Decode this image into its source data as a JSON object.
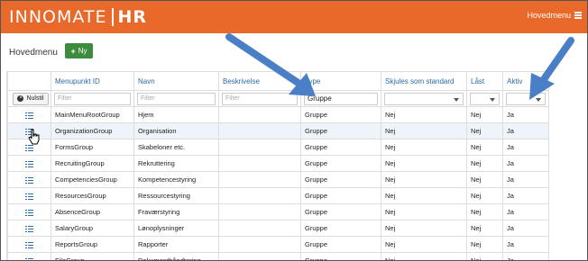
{
  "header": {
    "brand_name": "INNOMATE",
    "brand_suffix": "HR",
    "menu_label": "Hovedmenu",
    "color": "#e8692a"
  },
  "page": {
    "title": "Hovedmenu",
    "new_button": "Ny",
    "new_button_color": "#3d8b3d"
  },
  "grid": {
    "columns": [
      "Menupunkt ID",
      "Navn",
      "Beskrivelse",
      "Type",
      "Skjules som standard",
      "Låst",
      "Aktiv"
    ],
    "reset_label": "Nulstil",
    "filters": {
      "menupunkt_placeholder": "Filter",
      "navn_placeholder": "Filter",
      "beskrivelse_placeholder": "Filter",
      "type_value": "Gruppe"
    },
    "rows": [
      {
        "id": "MainMenuRootGroup",
        "navn": "Hjem",
        "beskrivelse": "",
        "type": "Gruppe",
        "skjules": "Nej",
        "laast": "Nej",
        "aktiv": "Ja"
      },
      {
        "id": "OrganizationGroup",
        "navn": "Organisation",
        "beskrivelse": "",
        "type": "Gruppe",
        "skjules": "Nej",
        "laast": "Nej",
        "aktiv": "Ja"
      },
      {
        "id": "FormsGroup",
        "navn": "Skabeloner etc.",
        "beskrivelse": "",
        "type": "Gruppe",
        "skjules": "Nej",
        "laast": "Nej",
        "aktiv": "Ja"
      },
      {
        "id": "RecruitingGroup",
        "navn": "Rekruttering",
        "beskrivelse": "",
        "type": "Gruppe",
        "skjules": "Nej",
        "laast": "Nej",
        "aktiv": "Ja"
      },
      {
        "id": "CompetenciesGroup",
        "navn": "Kompetencestyring",
        "beskrivelse": "",
        "type": "Gruppe",
        "skjules": "Nej",
        "laast": "Nej",
        "aktiv": "Ja"
      },
      {
        "id": "ResourcesGroup",
        "navn": "Ressourcestyring",
        "beskrivelse": "",
        "type": "Gruppe",
        "skjules": "Nej",
        "laast": "Nej",
        "aktiv": "Ja"
      },
      {
        "id": "AbsenceGroup",
        "navn": "Fraværstyring",
        "beskrivelse": "",
        "type": "Gruppe",
        "skjules": "Nej",
        "laast": "Nej",
        "aktiv": "Ja"
      },
      {
        "id": "SalaryGroup",
        "navn": "Lønoplysninger",
        "beskrivelse": "",
        "type": "Gruppe",
        "skjules": "Nej",
        "laast": "Nej",
        "aktiv": "Ja"
      },
      {
        "id": "ReportsGroup",
        "navn": "Rapporter",
        "beskrivelse": "",
        "type": "Gruppe",
        "skjules": "Nej",
        "laast": "Nej",
        "aktiv": "Ja"
      },
      {
        "id": "FileGroup",
        "navn": "Dokumenthåndtering",
        "beskrivelse": "",
        "type": "Gruppe",
        "skjules": "Nej",
        "laast": "Nej",
        "aktiv": "Ja"
      }
    ]
  },
  "annotation_arrow_color": "#4a7fc8"
}
